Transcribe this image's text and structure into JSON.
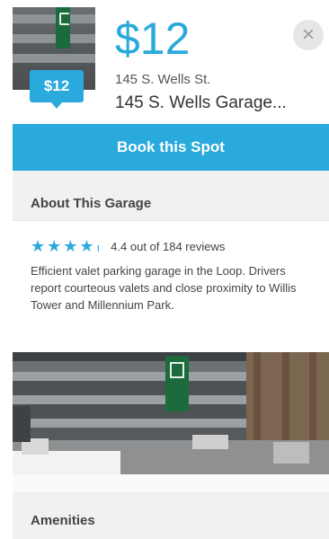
{
  "spot": {
    "badge_price": "$12",
    "price": "$12",
    "address_line1": "145 S. Wells St.",
    "address_line2": "145 S. Wells Garage..."
  },
  "actions": {
    "book_label": "Book this Spot",
    "close_icon": "close-icon"
  },
  "about": {
    "heading": "About This Garage",
    "stars": "★★★★",
    "half_star": "ı",
    "rating": 4.4,
    "rating_text": "4.4 out of 184 reviews",
    "description": "Efficient valet parking garage in the Loop. Drivers report courteous valets and close proximity to Willis Tower and Millennium Park."
  },
  "amenities": {
    "heading": "Amenities"
  },
  "colors": {
    "accent": "#29a9dc",
    "section_bg": "#f1f1f1"
  }
}
